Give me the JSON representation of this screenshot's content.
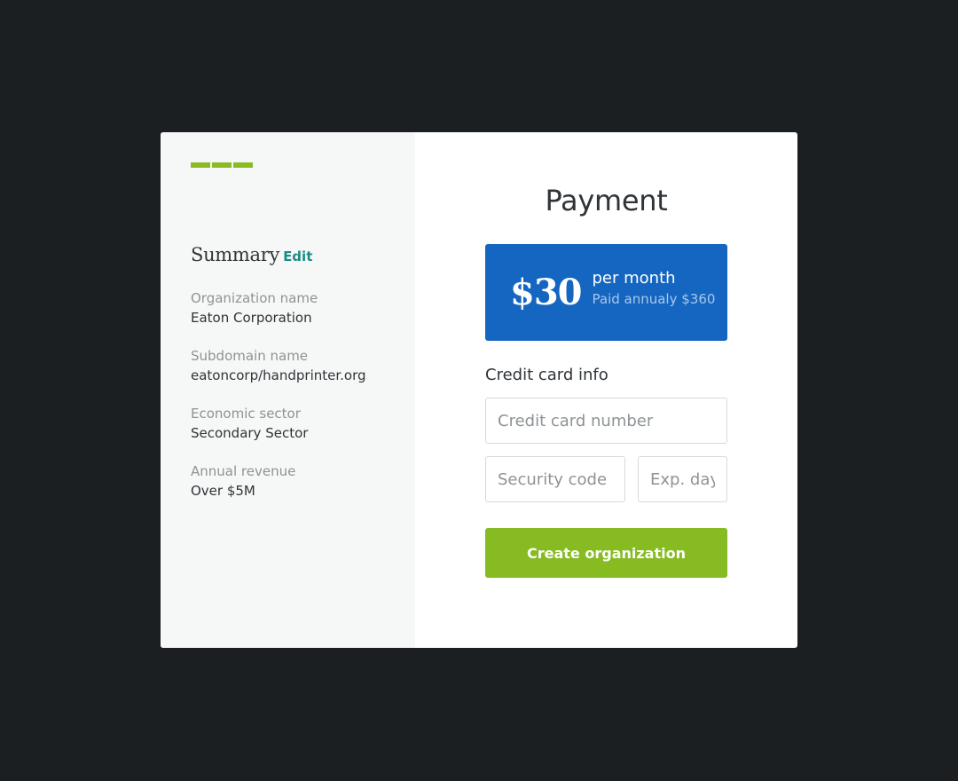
{
  "summary": {
    "title": "Summary",
    "edit_label": "Edit",
    "fields": [
      {
        "label": "Organization name",
        "value": "Eaton Corporation"
      },
      {
        "label": "Subdomain name",
        "value": "eatoncorp/handprinter.org"
      },
      {
        "label": "Economic sector",
        "value": "Secondary Sector"
      },
      {
        "label": "Annual revenue",
        "value": "Over $5M"
      }
    ]
  },
  "progress": {
    "completed_steps": 3,
    "total_steps": 3
  },
  "payment": {
    "title": "Payment",
    "price": "$30",
    "period": "per month",
    "annual_note": "Paid annualy $360",
    "credit_card_label": "Credit card info",
    "card_number_placeholder": "Credit card number",
    "security_code_placeholder": "Security code",
    "exp_day_placeholder": "Exp. day",
    "submit_label": "Create organization"
  },
  "colors": {
    "background": "#1b1f22",
    "accent_green": "#86bb22",
    "price_blue": "#1466c0",
    "edit_teal": "#1d8c86"
  }
}
